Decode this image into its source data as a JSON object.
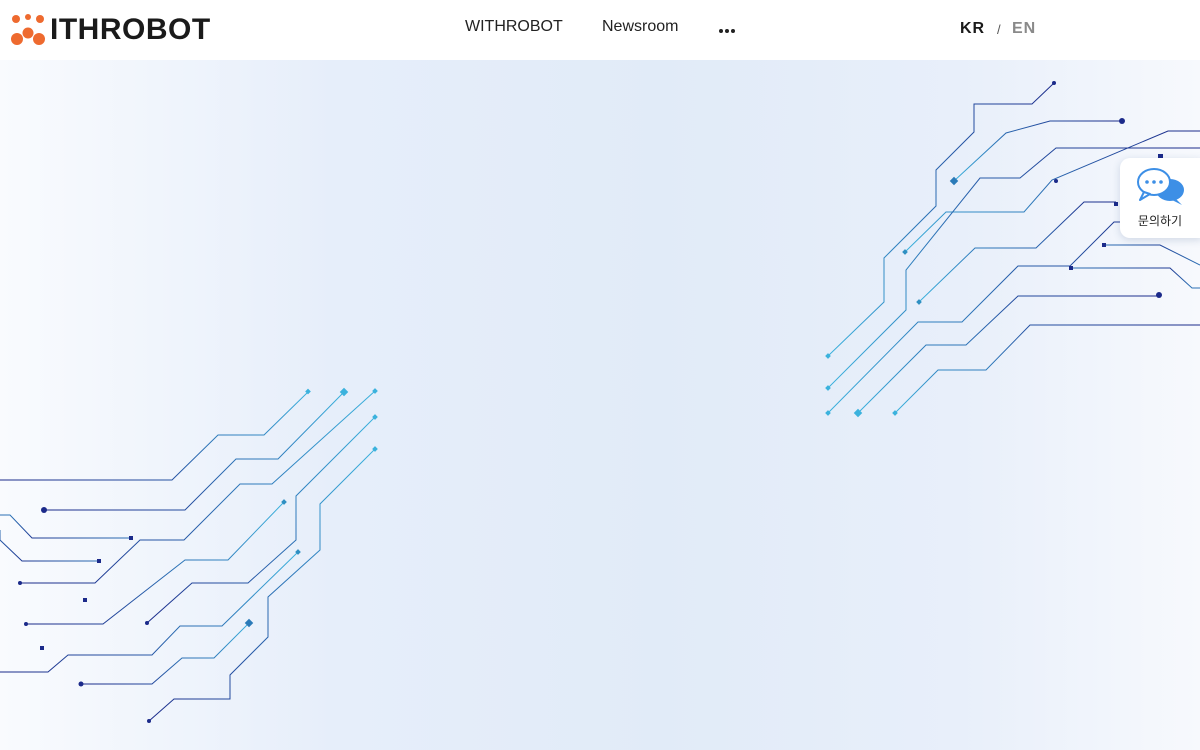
{
  "header": {
    "logo_text": "ITHROBOT",
    "nav": [
      {
        "label": "WITHROBOT"
      },
      {
        "label": "Newsroom"
      }
    ],
    "more_icon": "more-dots-icon",
    "lang": {
      "kr": "KR",
      "sep": "/",
      "en": "EN"
    }
  },
  "inquiry": {
    "label": "문의하기",
    "icon": "chat-bubbles-icon"
  },
  "colors": {
    "brand_orange": "#ee6a2f",
    "circuit_dark": "#1b2a8a",
    "circuit_light": "#39a9d8",
    "text_dark": "#1a1a1a",
    "lang_inactive": "#8a8a8a"
  }
}
